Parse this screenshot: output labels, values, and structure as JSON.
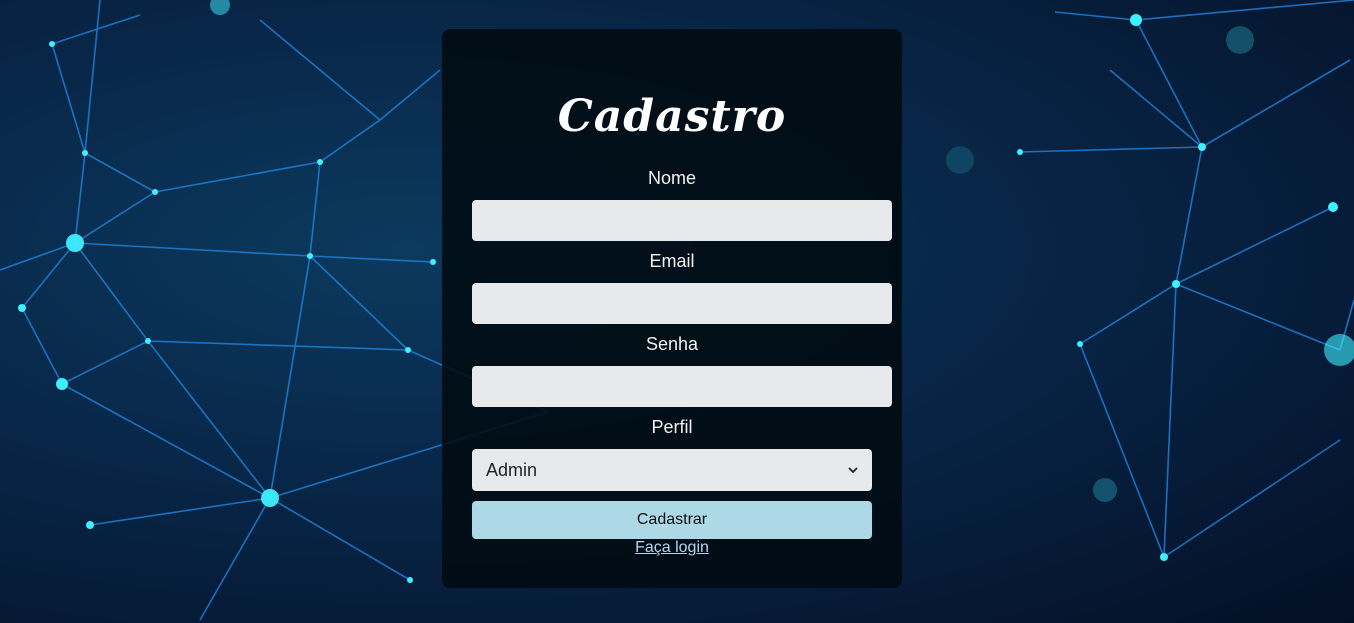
{
  "form": {
    "title": "Cadastro",
    "name_label": "Nome",
    "email_label": "Email",
    "password_label": "Senha",
    "profile_label": "Perfil",
    "name_value": "",
    "email_value": "",
    "password_value": "",
    "profile_selected": "Admin",
    "submit_label": "Cadastrar",
    "login_link": "Faça login"
  },
  "colors": {
    "button": "#add8e6",
    "input": "#e8e9eb",
    "panel": "#000a10"
  }
}
